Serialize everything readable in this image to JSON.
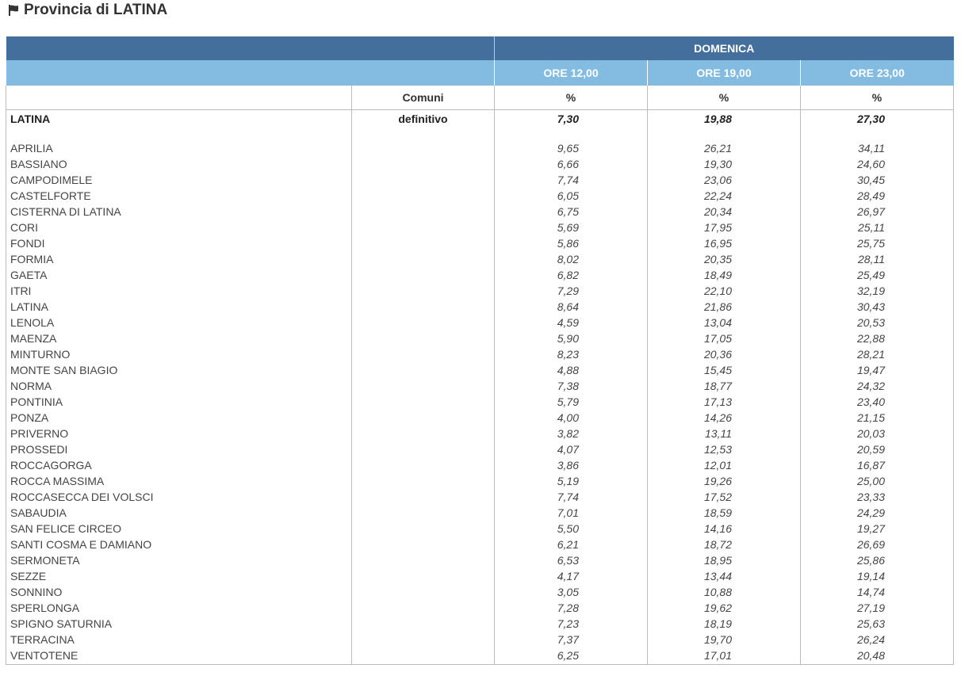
{
  "title": "Provincia di LATINA",
  "icons": {
    "title_icon": "flag-icon"
  },
  "colors": {
    "header_dark": "#446e9b",
    "header_light": "#83bce0"
  },
  "table": {
    "day_header": "DOMENICA",
    "time_headers": [
      "ORE 12,00",
      "ORE 19,00",
      "ORE 23,00"
    ],
    "col_comuni": "Comuni",
    "unit_headers": [
      "%",
      "%",
      "%"
    ],
    "summary": {
      "name": "LATINA",
      "status": "definitivo",
      "values": [
        "7,30",
        "19,88",
        "27,30"
      ]
    },
    "rows": [
      {
        "name": "APRILIA",
        "values": [
          "9,65",
          "26,21",
          "34,11"
        ]
      },
      {
        "name": "BASSIANO",
        "values": [
          "6,66",
          "19,30",
          "24,60"
        ]
      },
      {
        "name": "CAMPODIMELE",
        "values": [
          "7,74",
          "23,06",
          "30,45"
        ]
      },
      {
        "name": "CASTELFORTE",
        "values": [
          "6,05",
          "22,24",
          "28,49"
        ]
      },
      {
        "name": "CISTERNA DI LATINA",
        "values": [
          "6,75",
          "20,34",
          "26,97"
        ]
      },
      {
        "name": "CORI",
        "values": [
          "5,69",
          "17,95",
          "25,11"
        ]
      },
      {
        "name": "FONDI",
        "values": [
          "5,86",
          "16,95",
          "25,75"
        ]
      },
      {
        "name": "FORMIA",
        "values": [
          "8,02",
          "20,35",
          "28,11"
        ]
      },
      {
        "name": "GAETA",
        "values": [
          "6,82",
          "18,49",
          "25,49"
        ]
      },
      {
        "name": "ITRI",
        "values": [
          "7,29",
          "22,10",
          "32,19"
        ]
      },
      {
        "name": "LATINA",
        "values": [
          "8,64",
          "21,86",
          "30,43"
        ]
      },
      {
        "name": "LENOLA",
        "values": [
          "4,59",
          "13,04",
          "20,53"
        ]
      },
      {
        "name": "MAENZA",
        "values": [
          "5,90",
          "17,05",
          "22,88"
        ]
      },
      {
        "name": "MINTURNO",
        "values": [
          "8,23",
          "20,36",
          "28,21"
        ]
      },
      {
        "name": "MONTE SAN BIAGIO",
        "values": [
          "4,88",
          "15,45",
          "19,47"
        ]
      },
      {
        "name": "NORMA",
        "values": [
          "7,38",
          "18,77",
          "24,32"
        ]
      },
      {
        "name": "PONTINIA",
        "values": [
          "5,79",
          "17,13",
          "23,40"
        ]
      },
      {
        "name": "PONZA",
        "values": [
          "4,00",
          "14,26",
          "21,15"
        ]
      },
      {
        "name": "PRIVERNO",
        "values": [
          "3,82",
          "13,11",
          "20,03"
        ]
      },
      {
        "name": "PROSSEDI",
        "values": [
          "4,07",
          "12,53",
          "20,59"
        ]
      },
      {
        "name": "ROCCAGORGA",
        "values": [
          "3,86",
          "12,01",
          "16,87"
        ]
      },
      {
        "name": "ROCCA MASSIMA",
        "values": [
          "5,19",
          "19,26",
          "25,00"
        ]
      },
      {
        "name": "ROCCASECCA DEI VOLSCI",
        "values": [
          "7,74",
          "17,52",
          "23,33"
        ]
      },
      {
        "name": "SABAUDIA",
        "values": [
          "7,01",
          "18,59",
          "24,29"
        ]
      },
      {
        "name": "SAN FELICE CIRCEO",
        "values": [
          "5,50",
          "14,16",
          "19,27"
        ]
      },
      {
        "name": "SANTI COSMA E DAMIANO",
        "values": [
          "6,21",
          "18,72",
          "26,69"
        ]
      },
      {
        "name": "SERMONETA",
        "values": [
          "6,53",
          "18,95",
          "25,86"
        ]
      },
      {
        "name": "SEZZE",
        "values": [
          "4,17",
          "13,44",
          "19,14"
        ]
      },
      {
        "name": "SONNINO",
        "values": [
          "3,05",
          "10,88",
          "14,74"
        ]
      },
      {
        "name": "SPERLONGA",
        "values": [
          "7,28",
          "19,62",
          "27,19"
        ]
      },
      {
        "name": "SPIGNO SATURNIA",
        "values": [
          "7,23",
          "18,19",
          "25,63"
        ]
      },
      {
        "name": "TERRACINA",
        "values": [
          "7,37",
          "19,70",
          "26,24"
        ]
      },
      {
        "name": "VENTOTENE",
        "values": [
          "6,25",
          "17,01",
          "20,48"
        ]
      }
    ]
  }
}
